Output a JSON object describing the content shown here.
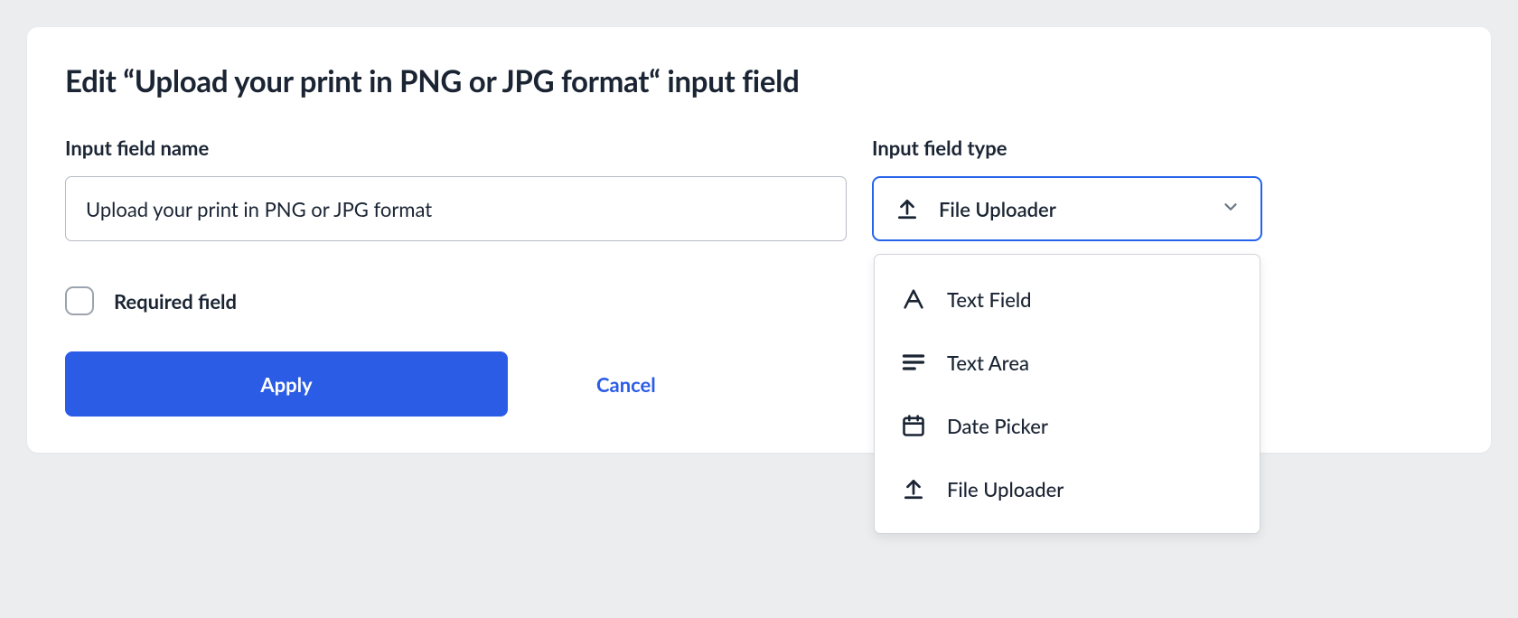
{
  "title": "Edit “Upload your print in PNG or JPG format“ input field",
  "fieldName": {
    "label": "Input field name",
    "value": "Upload your print in PNG or JPG format"
  },
  "fieldType": {
    "label": "Input field type",
    "selected": "File Uploader",
    "options": [
      {
        "icon": "text-field",
        "label": "Text Field"
      },
      {
        "icon": "text-area",
        "label": "Text Area"
      },
      {
        "icon": "date-picker",
        "label": "Date Picker"
      },
      {
        "icon": "file-uploader",
        "label": "File Uploader"
      }
    ]
  },
  "required": {
    "label": "Required field",
    "checked": false
  },
  "actions": {
    "apply": "Apply",
    "cancel": "Cancel"
  }
}
